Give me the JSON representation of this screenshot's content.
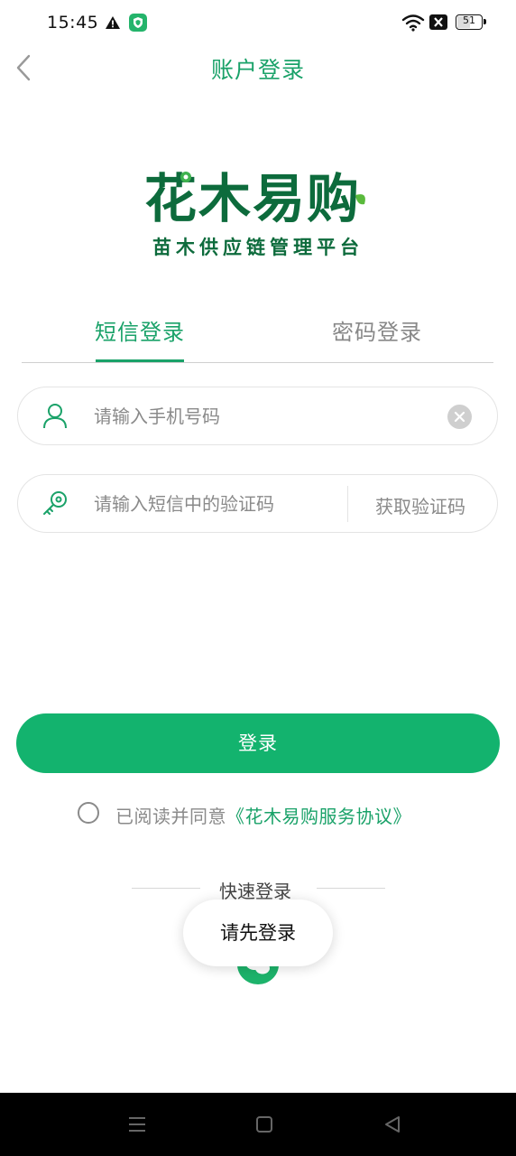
{
  "status_bar": {
    "time": "15:45",
    "battery": "51",
    "battery_level": 0.51,
    "icons": [
      "warning-icon",
      "shield-app-icon",
      "wifi-icon",
      "sim-x-icon",
      "battery-icon"
    ]
  },
  "header": {
    "title": "账户登录",
    "back_icon": "chevron-left-icon"
  },
  "logo": {
    "brand": "花木易购",
    "subtitle": "苗木供应链管理平台"
  },
  "tabs": [
    {
      "label": "短信登录",
      "active": true
    },
    {
      "label": "密码登录",
      "active": false
    }
  ],
  "form": {
    "phone_placeholder": "请输入手机号码",
    "code_placeholder": "请输入短信中的验证码",
    "get_code_label": "获取验证码"
  },
  "login_button": "登录",
  "agreement": {
    "prefix": "已阅读并同意",
    "link": "《花木易购服务协议》"
  },
  "quick_login": {
    "label": "快速登录",
    "icon": "wechat-icon"
  },
  "toast": "请先登录",
  "colors": {
    "accent": "#13b36e",
    "accent_text": "#1aa269",
    "logo_green": "#0d6b3c"
  }
}
